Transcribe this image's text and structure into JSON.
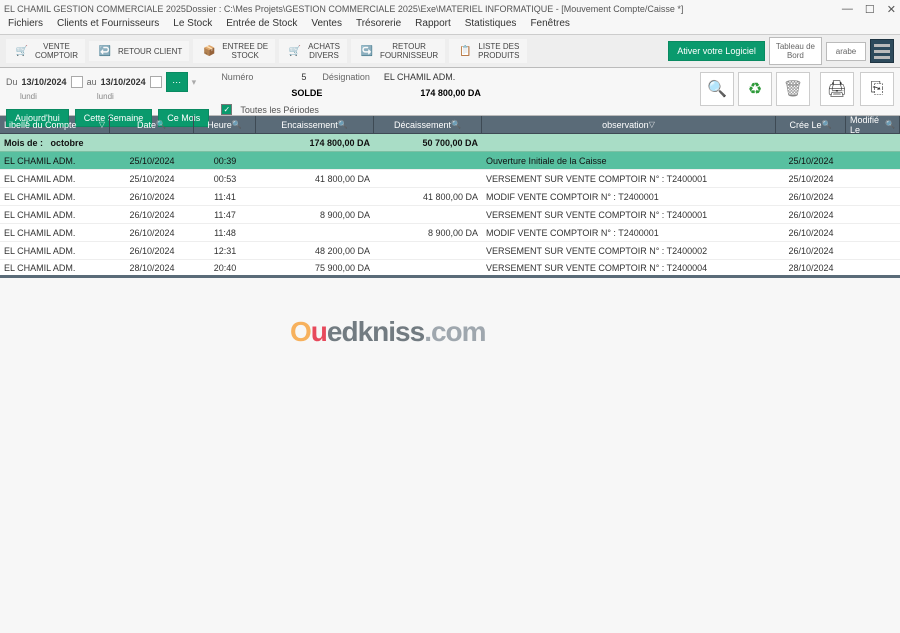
{
  "title": "EL CHAMIL GESTION COMMERCIALE 2025Dossier : C:\\Mes Projets\\GESTION COMMERCIALE 2025\\Exe\\MATERIEL INFORMATIQUE - [Mouvement Compte/Caisse *]",
  "menu": [
    "Fichiers",
    "Clients et Fournisseurs",
    "Le Stock",
    "Entrée de Stock",
    "Ventes",
    "Trésorerie",
    "Rapport",
    "Statistiques",
    "Fenêtres"
  ],
  "toolbar": {
    "vente_comptoir": "VENTE\nCOMPTOIR",
    "retour_client": "RETOUR CLIENT",
    "entree_stock": "ENTREE DE\nSTOCK",
    "achats_divers": "ACHATS\nDIVERS",
    "retour_fournisseur": "RETOUR\nFOURNISSEUR",
    "liste_produits": "LISTE DES\nPRODUITS",
    "activer": "Ativer votre Logiciel",
    "tableau_bord": "Tableau de\nBord",
    "arabe": "arabe"
  },
  "filter": {
    "du_label": "Du",
    "du_value": "13/10/2024",
    "du_day": "lundi",
    "au_label": "au",
    "au_value": "13/10/2024",
    "au_day": "lundi",
    "period_today": "Aujourd'hui",
    "period_week": "Cette Semaine",
    "period_month": "Ce Mois"
  },
  "info": {
    "numero_label": "Numéro",
    "numero_value": "5",
    "designation_label": "Désignation",
    "designation_value": "EL CHAMIL ADM.",
    "solde_label": "SOLDE",
    "solde_value": "174 800,00 DA",
    "toutes_periodes": "Toutes les Périodes"
  },
  "headers": {
    "compte": "Libellé du Compte",
    "date": "Date",
    "heure": "Heure",
    "enc": "Encaissement",
    "dec": "Décaissement",
    "obs": "observation",
    "cree": "Crée Le",
    "mod": "Modifié Le"
  },
  "summary": {
    "mois_label": "Mois de :",
    "mois_value": "octobre",
    "enc_total": "174 800,00 DA",
    "dec_total": "50 700,00 DA"
  },
  "rows": [
    {
      "compte": "EL CHAMIL ADM.",
      "date": "25/10/2024",
      "heure": "00:39",
      "enc": "",
      "dec": "",
      "obs": "Ouverture Initiale de la Caisse",
      "cree": "25/10/2024"
    },
    {
      "compte": "EL CHAMIL ADM.",
      "date": "25/10/2024",
      "heure": "00:53",
      "enc": "41 800,00 DA",
      "dec": "",
      "obs": "VERSEMENT SUR VENTE COMPTOIR N° : T2400001",
      "cree": "25/10/2024"
    },
    {
      "compte": "EL CHAMIL ADM.",
      "date": "26/10/2024",
      "heure": "11:41",
      "enc": "",
      "dec": "41 800,00 DA",
      "obs": "MODIF VENTE COMPTOIR N° : T2400001",
      "cree": "26/10/2024"
    },
    {
      "compte": "EL CHAMIL ADM.",
      "date": "26/10/2024",
      "heure": "11:47",
      "enc": "8 900,00 DA",
      "dec": "",
      "obs": "VERSEMENT SUR VENTE COMPTOIR N° : T2400001",
      "cree": "26/10/2024"
    },
    {
      "compte": "EL CHAMIL ADM.",
      "date": "26/10/2024",
      "heure": "11:48",
      "enc": "",
      "dec": "8 900,00 DA",
      "obs": "MODIF VENTE COMPTOIR N° : T2400001",
      "cree": "26/10/2024"
    },
    {
      "compte": "EL CHAMIL ADM.",
      "date": "26/10/2024",
      "heure": "12:31",
      "enc": "48 200,00 DA",
      "dec": "",
      "obs": "VERSEMENT SUR VENTE COMPTOIR N° : T2400002",
      "cree": "26/10/2024"
    },
    {
      "compte": "EL CHAMIL ADM.",
      "date": "28/10/2024",
      "heure": "20:40",
      "enc": "75 900,00 DA",
      "dec": "",
      "obs": "VERSEMENT SUR VENTE COMPTOIR N° : T2400004",
      "cree": "28/10/2024"
    }
  ],
  "watermark": {
    "p1": "O",
    "p2": "u",
    "p3": "ed",
    "p4": "kniss",
    "p5": ".com"
  }
}
